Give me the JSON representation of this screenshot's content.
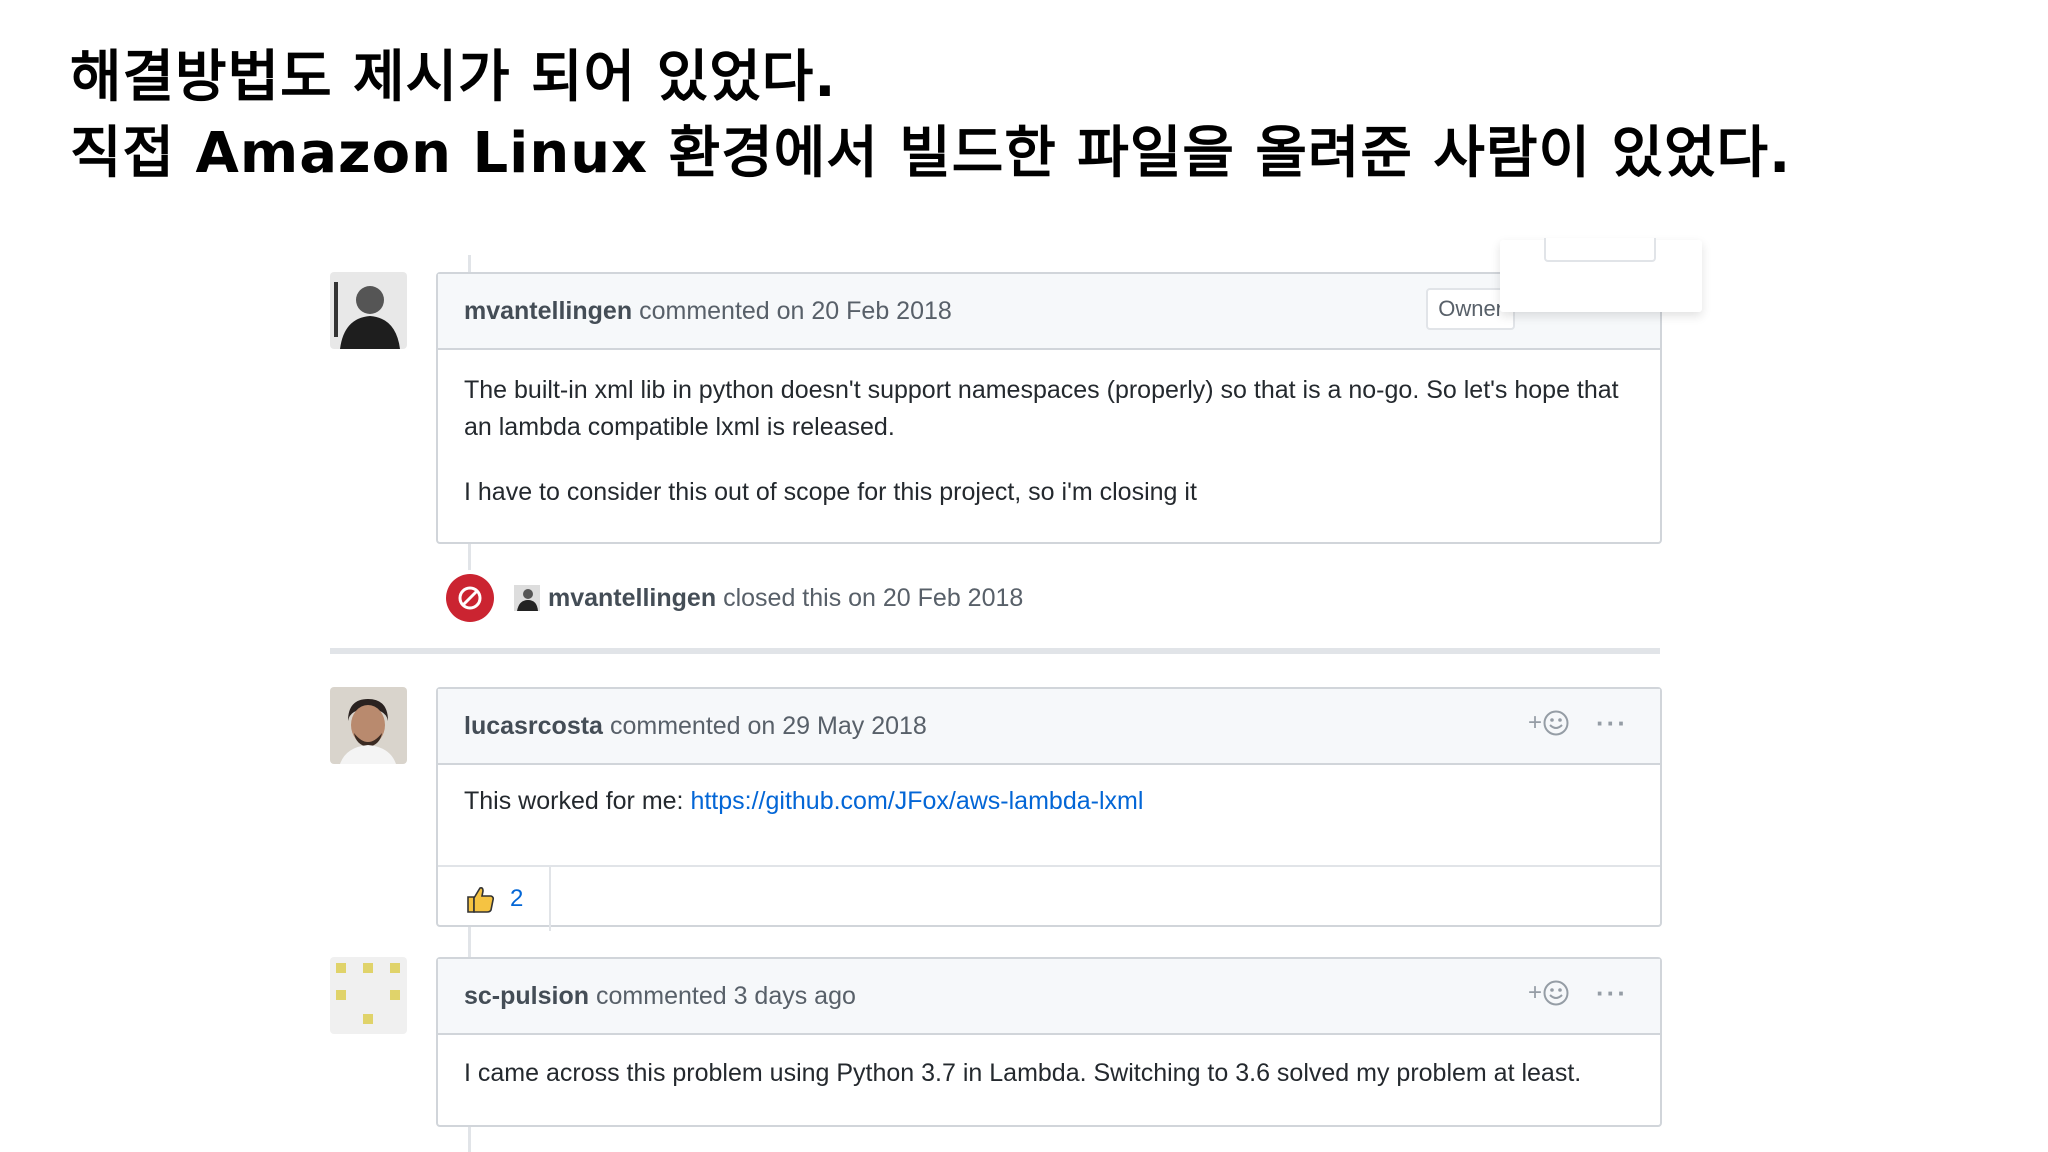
{
  "slide": {
    "line1": "해결방법도 제시가 되어 있었다.",
    "line2": "직접 Amazon Linux 환경에서 빌드한 파일을 올려준 사람이 있었다."
  },
  "comments": [
    {
      "author": "mvantellingen",
      "meta": "commented on 20 Feb 2018",
      "badge": "Owner",
      "body": [
        "The built-in xml lib in python doesn't support namespaces (properly) so that is a no-go. So let's hope that an lambda compatible lxml is released.",
        "I have to consider this out of scope for this project, so i'm closing it"
      ]
    },
    {
      "author": "lucasrcosta",
      "meta": "commented on 29 May 2018",
      "body_prefix": "This worked for me: ",
      "link": "https://github.com/JFox/aws-lambda-lxml",
      "reaction_count": "2",
      "react_symbol": "+",
      "more_symbol": "···"
    },
    {
      "author": "sc-pulsion",
      "meta": "commented 3 days ago",
      "body": "I came across this problem using Python 3.7 in Lambda. Switching to 3.6 solved my problem at least.",
      "react_symbol": "+",
      "more_symbol": "···"
    }
  ],
  "closed_event": {
    "author": "mvantellingen",
    "text": "closed this on 20 Feb 2018"
  },
  "colors": {
    "link": "#0366d6",
    "closed_red": "#cb2431",
    "identicon": "#e0d36a"
  },
  "icons": {
    "closed": "circle-slash-icon",
    "reaction": "smiley-icon",
    "thumbs": "thumbs-up-icon"
  }
}
